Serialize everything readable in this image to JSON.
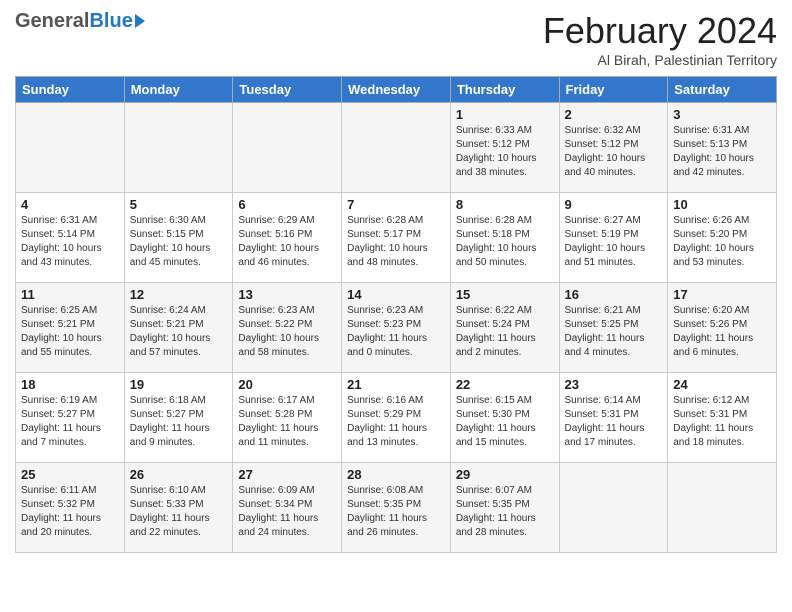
{
  "header": {
    "logo_general": "General",
    "logo_blue": "Blue",
    "month_title": "February 2024",
    "location": "Al Birah, Palestinian Territory"
  },
  "days_of_week": [
    "Sunday",
    "Monday",
    "Tuesday",
    "Wednesday",
    "Thursday",
    "Friday",
    "Saturday"
  ],
  "weeks": [
    {
      "days": [
        {
          "num": "",
          "info": ""
        },
        {
          "num": "",
          "info": ""
        },
        {
          "num": "",
          "info": ""
        },
        {
          "num": "",
          "info": ""
        },
        {
          "num": "1",
          "info": "Sunrise: 6:33 AM\nSunset: 5:12 PM\nDaylight: 10 hours\nand 38 minutes."
        },
        {
          "num": "2",
          "info": "Sunrise: 6:32 AM\nSunset: 5:12 PM\nDaylight: 10 hours\nand 40 minutes."
        },
        {
          "num": "3",
          "info": "Sunrise: 6:31 AM\nSunset: 5:13 PM\nDaylight: 10 hours\nand 42 minutes."
        }
      ]
    },
    {
      "days": [
        {
          "num": "4",
          "info": "Sunrise: 6:31 AM\nSunset: 5:14 PM\nDaylight: 10 hours\nand 43 minutes."
        },
        {
          "num": "5",
          "info": "Sunrise: 6:30 AM\nSunset: 5:15 PM\nDaylight: 10 hours\nand 45 minutes."
        },
        {
          "num": "6",
          "info": "Sunrise: 6:29 AM\nSunset: 5:16 PM\nDaylight: 10 hours\nand 46 minutes."
        },
        {
          "num": "7",
          "info": "Sunrise: 6:28 AM\nSunset: 5:17 PM\nDaylight: 10 hours\nand 48 minutes."
        },
        {
          "num": "8",
          "info": "Sunrise: 6:28 AM\nSunset: 5:18 PM\nDaylight: 10 hours\nand 50 minutes."
        },
        {
          "num": "9",
          "info": "Sunrise: 6:27 AM\nSunset: 5:19 PM\nDaylight: 10 hours\nand 51 minutes."
        },
        {
          "num": "10",
          "info": "Sunrise: 6:26 AM\nSunset: 5:20 PM\nDaylight: 10 hours\nand 53 minutes."
        }
      ]
    },
    {
      "days": [
        {
          "num": "11",
          "info": "Sunrise: 6:25 AM\nSunset: 5:21 PM\nDaylight: 10 hours\nand 55 minutes."
        },
        {
          "num": "12",
          "info": "Sunrise: 6:24 AM\nSunset: 5:21 PM\nDaylight: 10 hours\nand 57 minutes."
        },
        {
          "num": "13",
          "info": "Sunrise: 6:23 AM\nSunset: 5:22 PM\nDaylight: 10 hours\nand 58 minutes."
        },
        {
          "num": "14",
          "info": "Sunrise: 6:23 AM\nSunset: 5:23 PM\nDaylight: 11 hours\nand 0 minutes."
        },
        {
          "num": "15",
          "info": "Sunrise: 6:22 AM\nSunset: 5:24 PM\nDaylight: 11 hours\nand 2 minutes."
        },
        {
          "num": "16",
          "info": "Sunrise: 6:21 AM\nSunset: 5:25 PM\nDaylight: 11 hours\nand 4 minutes."
        },
        {
          "num": "17",
          "info": "Sunrise: 6:20 AM\nSunset: 5:26 PM\nDaylight: 11 hours\nand 6 minutes."
        }
      ]
    },
    {
      "days": [
        {
          "num": "18",
          "info": "Sunrise: 6:19 AM\nSunset: 5:27 PM\nDaylight: 11 hours\nand 7 minutes."
        },
        {
          "num": "19",
          "info": "Sunrise: 6:18 AM\nSunset: 5:27 PM\nDaylight: 11 hours\nand 9 minutes."
        },
        {
          "num": "20",
          "info": "Sunrise: 6:17 AM\nSunset: 5:28 PM\nDaylight: 11 hours\nand 11 minutes."
        },
        {
          "num": "21",
          "info": "Sunrise: 6:16 AM\nSunset: 5:29 PM\nDaylight: 11 hours\nand 13 minutes."
        },
        {
          "num": "22",
          "info": "Sunrise: 6:15 AM\nSunset: 5:30 PM\nDaylight: 11 hours\nand 15 minutes."
        },
        {
          "num": "23",
          "info": "Sunrise: 6:14 AM\nSunset: 5:31 PM\nDaylight: 11 hours\nand 17 minutes."
        },
        {
          "num": "24",
          "info": "Sunrise: 6:12 AM\nSunset: 5:31 PM\nDaylight: 11 hours\nand 18 minutes."
        }
      ]
    },
    {
      "days": [
        {
          "num": "25",
          "info": "Sunrise: 6:11 AM\nSunset: 5:32 PM\nDaylight: 11 hours\nand 20 minutes."
        },
        {
          "num": "26",
          "info": "Sunrise: 6:10 AM\nSunset: 5:33 PM\nDaylight: 11 hours\nand 22 minutes."
        },
        {
          "num": "27",
          "info": "Sunrise: 6:09 AM\nSunset: 5:34 PM\nDaylight: 11 hours\nand 24 minutes."
        },
        {
          "num": "28",
          "info": "Sunrise: 6:08 AM\nSunset: 5:35 PM\nDaylight: 11 hours\nand 26 minutes."
        },
        {
          "num": "29",
          "info": "Sunrise: 6:07 AM\nSunset: 5:35 PM\nDaylight: 11 hours\nand 28 minutes."
        },
        {
          "num": "",
          "info": ""
        },
        {
          "num": "",
          "info": ""
        }
      ]
    }
  ]
}
